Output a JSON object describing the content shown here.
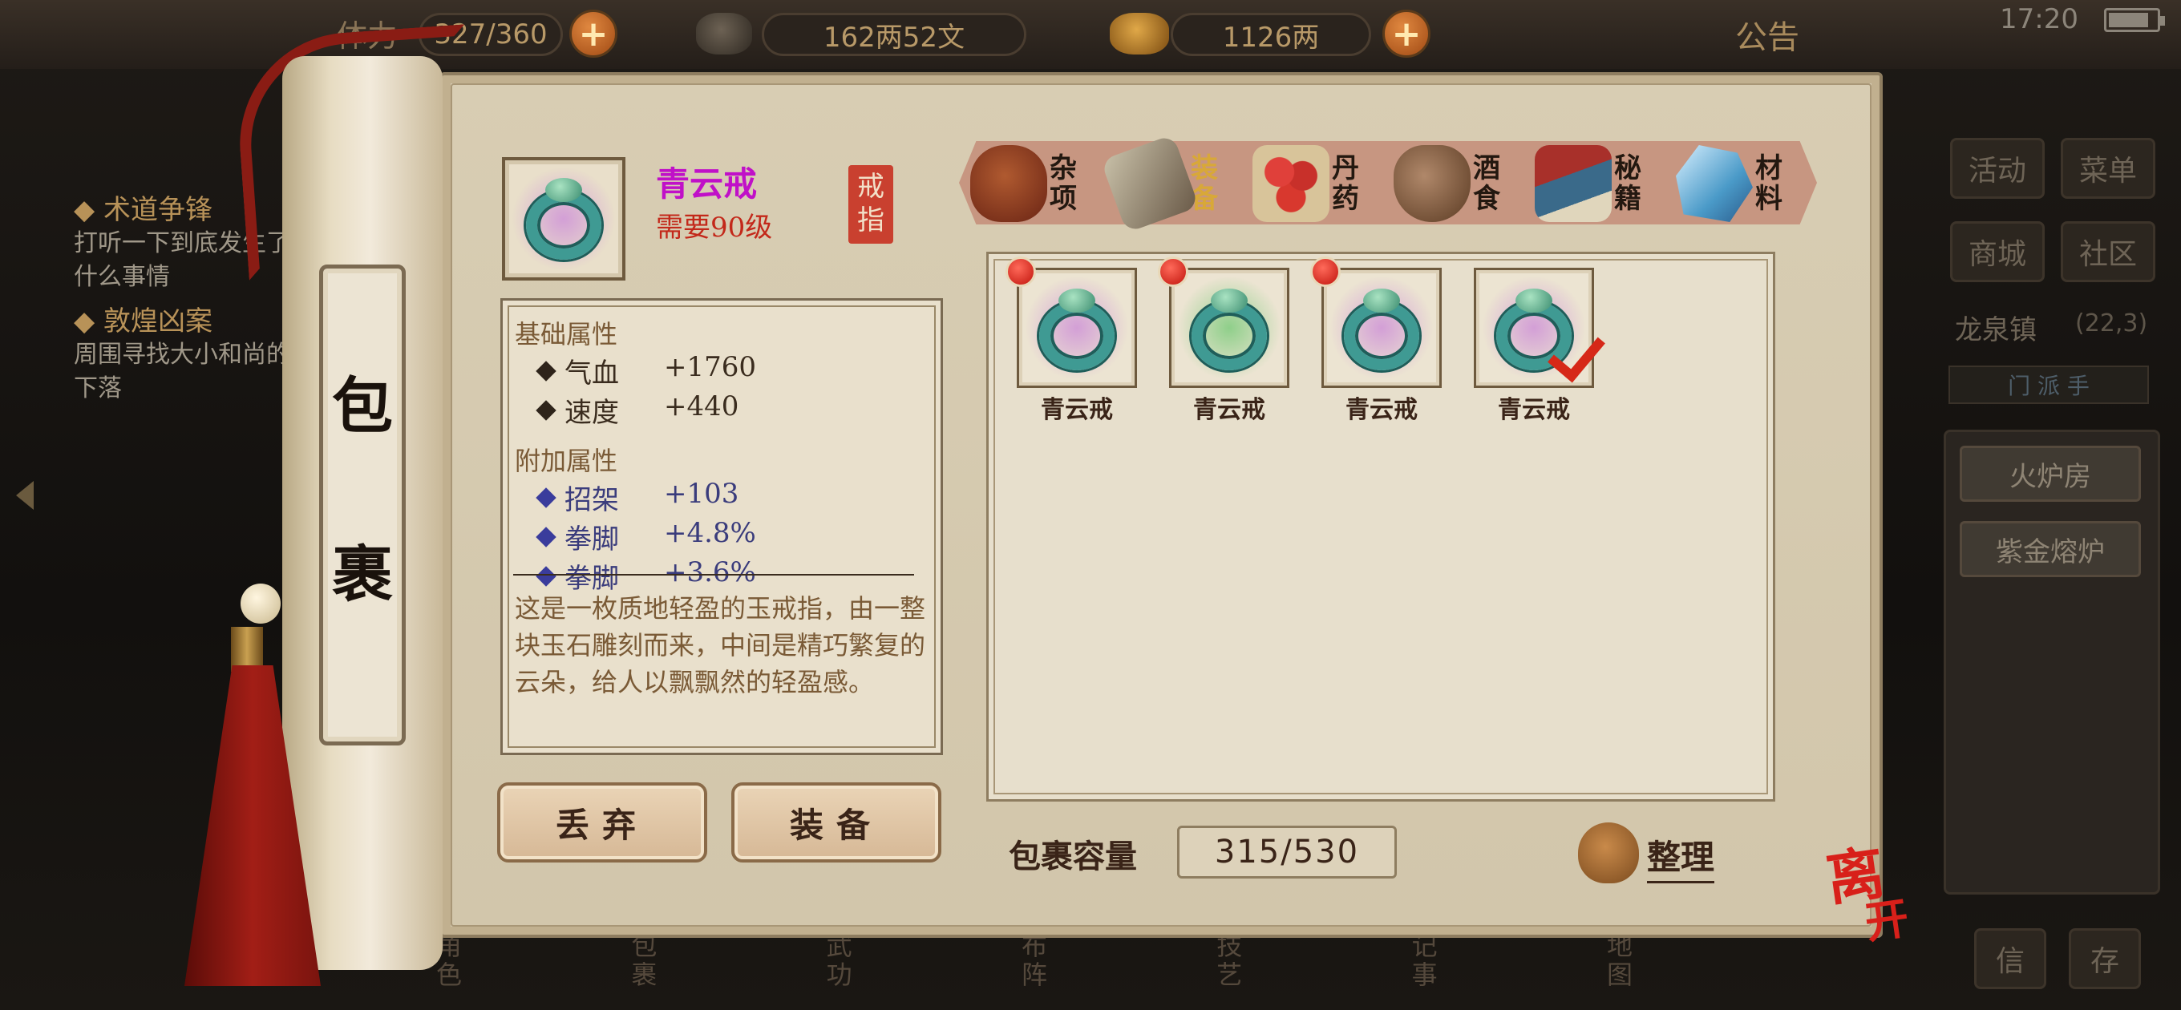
{
  "status_bar": {
    "time": "17:20",
    "battery_percent": 85
  },
  "top_bar": {
    "stamina_label": "体力",
    "stamina_value": "327/360",
    "silver": "162两52文",
    "gold": "1126两",
    "notice": "公告"
  },
  "quests": [
    {
      "title": "术道争锋",
      "desc": [
        "打听一下到底发生了",
        "什么事情"
      ]
    },
    {
      "title": "敦煌凶案",
      "desc": [
        "周围寻找大小和尚的",
        "下落"
      ]
    }
  ],
  "right_panel": {
    "buttons": [
      "活动",
      "菜单",
      "商城",
      "社区"
    ],
    "location": "龙泉镇",
    "coords": "(22,3)",
    "channel": "门 派 手",
    "list": [
      "火炉房",
      "紫金熔炉"
    ],
    "bottom": [
      "信",
      "存"
    ]
  },
  "bottom_nav": [
    "角色",
    "包裹",
    "武功",
    "布阵",
    "技艺",
    "记事",
    "地图"
  ],
  "scroll_title": [
    "包",
    "裹"
  ],
  "item": {
    "name": "青云戒",
    "requirement": "需要90级",
    "type_stamp": [
      "戒",
      "指"
    ],
    "base_header": "基础属性",
    "base_attrs": [
      {
        "name": "气血",
        "value": "+1760"
      },
      {
        "name": "速度",
        "value": "+440"
      }
    ],
    "extra_header": "附加属性",
    "extra_attrs": [
      {
        "name": "招架",
        "value": "+103"
      },
      {
        "name": "拳脚",
        "value": "+4.8%"
      },
      {
        "name": "拳脚",
        "value": "+3.6%"
      }
    ],
    "description": "这是一枚质地轻盈的玉戒指，由一整块玉石雕刻而来，中间是精巧繁复的云朵，给人以飘飘然的轻盈感。"
  },
  "actions": {
    "discard": "丢弃",
    "equip": "装备"
  },
  "tabs": [
    {
      "label": "杂项",
      "icon": "jar-icon",
      "active": false
    },
    {
      "label": "装备",
      "icon": "equipment-icon",
      "active": true
    },
    {
      "label": "丹药",
      "icon": "pill-icon",
      "active": false
    },
    {
      "label": "酒食",
      "icon": "food-icon",
      "active": false
    },
    {
      "label": "秘籍",
      "icon": "book-icon",
      "active": false
    },
    {
      "label": "材料",
      "icon": "crystal-icon",
      "active": false
    }
  ],
  "inventory": [
    {
      "name": "青云戒",
      "new": true,
      "equipped": false,
      "aura": "purple"
    },
    {
      "name": "青云戒",
      "new": true,
      "equipped": false,
      "aura": "green"
    },
    {
      "name": "青云戒",
      "new": true,
      "equipped": false,
      "aura": "purple"
    },
    {
      "name": "青云戒",
      "new": false,
      "equipped": true,
      "aura": "purple"
    }
  ],
  "capacity": {
    "label": "包裹容量",
    "value": "315/530"
  },
  "sort_label": "整理",
  "leave_label": [
    "离",
    "开"
  ],
  "colors": {
    "item_name": "#c010c8",
    "requirement": "#c3281a",
    "extra_attr": "#3a3c7c",
    "active_tab": "#d8a838"
  }
}
